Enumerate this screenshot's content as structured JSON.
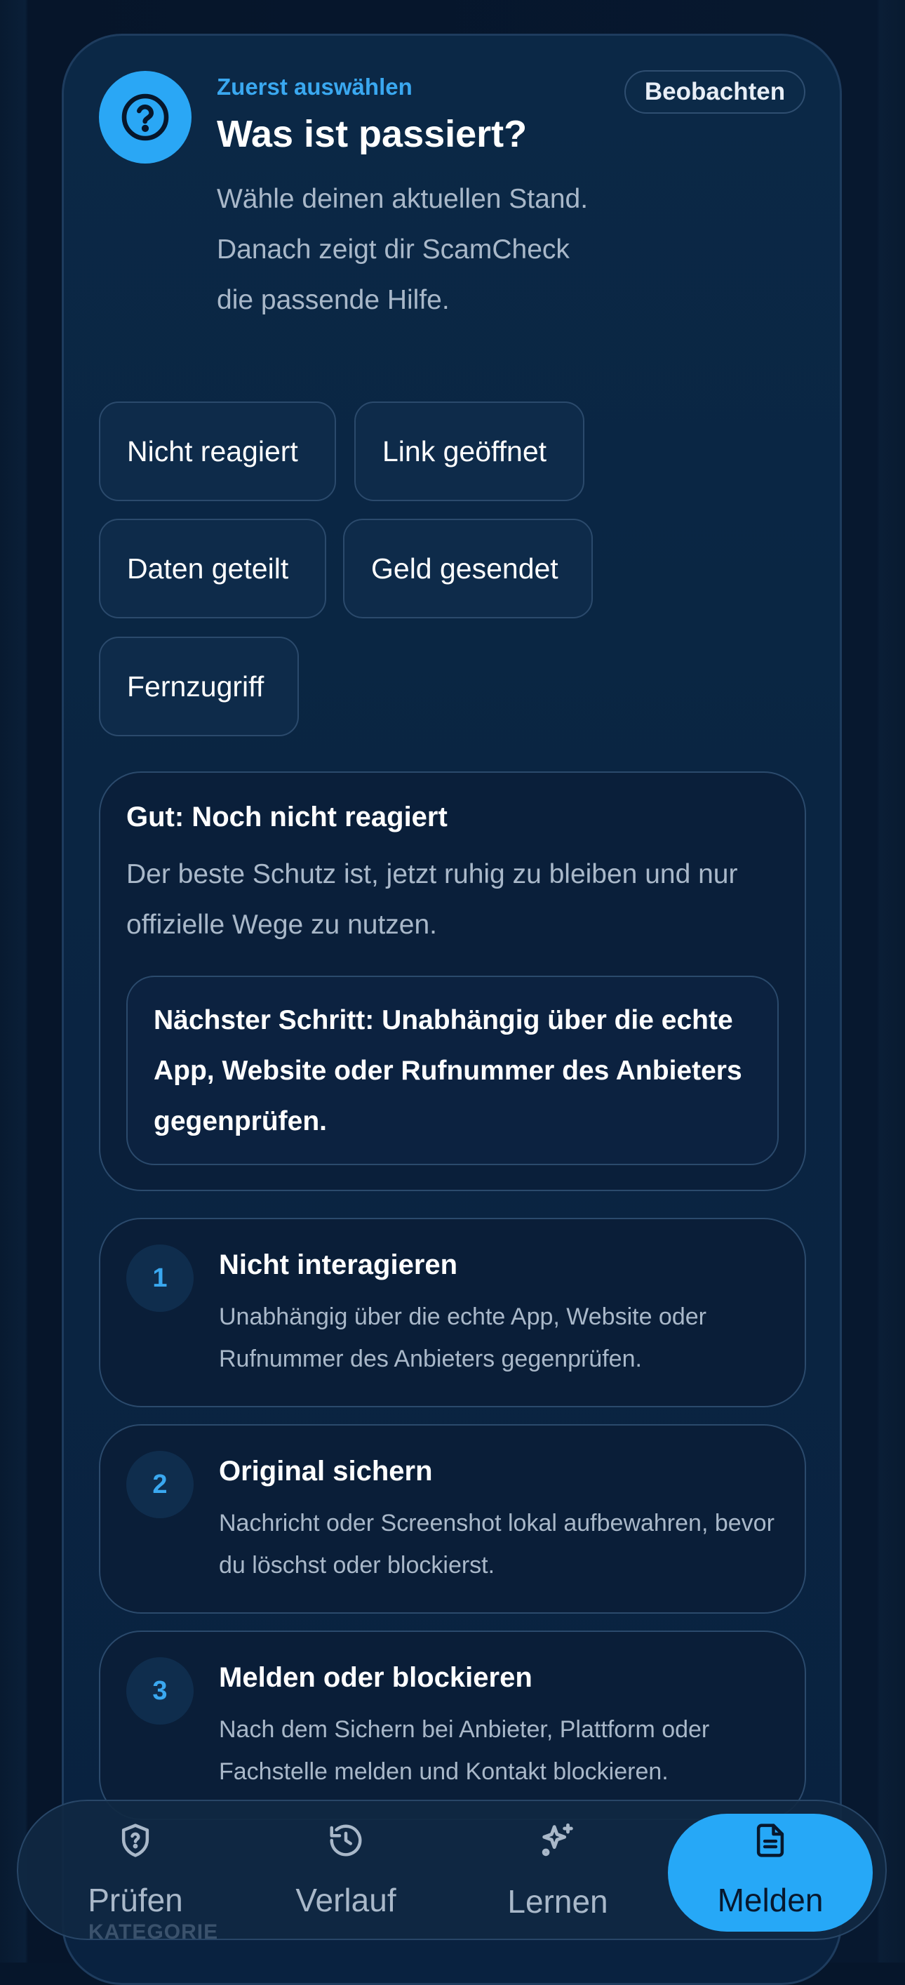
{
  "header": {
    "eyebrow": "Zuerst auswählen",
    "title": "Was ist passiert?",
    "subtitle": "Wähle deinen aktuellen Stand. Danach zeigt dir ScamCheck die passende Hilfe.",
    "observe_label": "Beobachten",
    "icon": "help-circle-icon"
  },
  "options": [
    {
      "label": "Nicht reagiert"
    },
    {
      "label": "Link geöffnet"
    },
    {
      "label": "Daten geteilt"
    },
    {
      "label": "Geld gesendet"
    },
    {
      "label": "Fernzugriff"
    }
  ],
  "status": {
    "title": "Gut: Noch nicht reagiert",
    "text": "Der beste Schutz ist, jetzt ruhig zu bleiben und nur offizielle Wege zu nutzen.",
    "next_step": "Nächster Schritt: Unabhängig über die echte App, Website oder Rufnummer des Anbieters gegenprüfen."
  },
  "steps": [
    {
      "num": "1",
      "title": "Nicht interagieren",
      "text": "Unabhängig über die echte App, Website oder Rufnummer des Anbieters gegenprüfen."
    },
    {
      "num": "2",
      "title": "Original sichern",
      "text": "Nachricht oder Screenshot lokal aufbewahren, bevor du löschst oder blockierst."
    },
    {
      "num": "3",
      "title": "Melden oder blockieren",
      "text": "Nach dem Sichern bei Anbieter, Plattform oder Fachstelle melden und Kontakt blockieren."
    }
  ],
  "nav": {
    "items": [
      {
        "label": "Prüfen",
        "icon": "shield-question-icon"
      },
      {
        "label": "Verlauf",
        "icon": "history-icon"
      },
      {
        "label": "Lernen",
        "icon": "sparkles-icon"
      },
      {
        "label": "Melden",
        "icon": "document-icon"
      }
    ],
    "active": "Melden"
  },
  "background_label": "KATEGORIE",
  "colors": {
    "accent": "#26a8f7",
    "background": "#06162b",
    "card": "#0b2846",
    "muted_text": "#a9b8c9"
  }
}
